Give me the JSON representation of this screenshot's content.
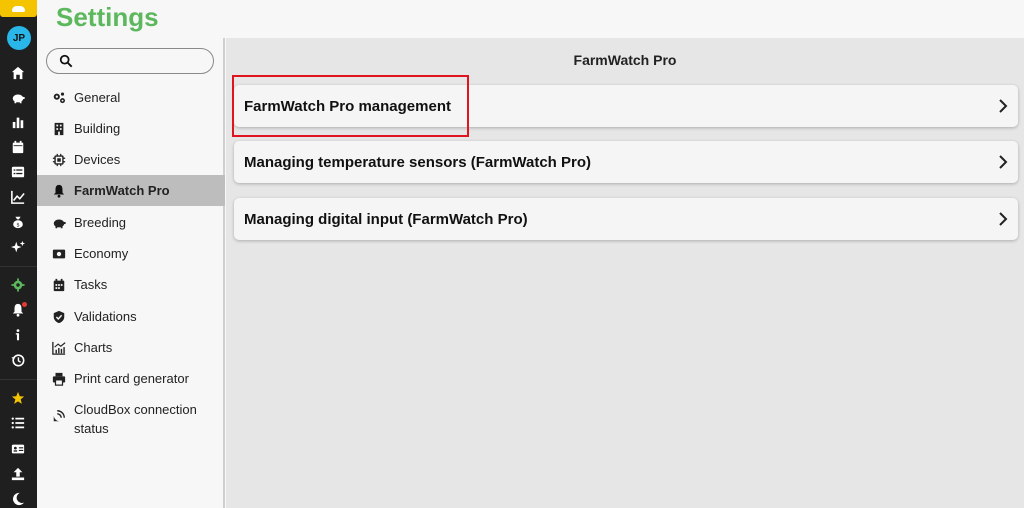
{
  "app": {
    "title": "Settings"
  },
  "rail": {
    "avatar_initials": "JP",
    "icons": [
      "home-icon",
      "piggy-bank-icon",
      "bar-chart-icon",
      "calendar-icon",
      "list-icon",
      "line-chart-icon",
      "money-bag-icon",
      "sparkles-icon",
      "gear-icon",
      "bell-icon",
      "info-icon",
      "history-icon",
      "star-icon",
      "list-icon",
      "id-card-icon",
      "upload-icon",
      "moon-icon"
    ]
  },
  "search": {
    "placeholder": ""
  },
  "nav": {
    "items": [
      {
        "label": "General",
        "icon": "gears-icon"
      },
      {
        "label": "Building",
        "icon": "building-icon"
      },
      {
        "label": "Devices",
        "icon": "chip-icon"
      },
      {
        "label": "FarmWatch Pro",
        "icon": "bell-icon",
        "active": true
      },
      {
        "label": "Breeding",
        "icon": "piggy-bank-icon"
      },
      {
        "label": "Economy",
        "icon": "money-icon"
      },
      {
        "label": "Tasks",
        "icon": "calendar-icon"
      },
      {
        "label": "Validations",
        "icon": "shield-check-icon"
      },
      {
        "label": "Charts",
        "icon": "chart-icon"
      },
      {
        "label": "Print card generator",
        "icon": "printer-icon"
      },
      {
        "label": "CloudBox connection status",
        "icon": "satellite-icon"
      }
    ]
  },
  "main": {
    "header": "FarmWatch Pro",
    "cards": [
      {
        "label": "FarmWatch Pro management"
      },
      {
        "label": "Managing temperature sensors (FarmWatch Pro)"
      },
      {
        "label": "Managing digital input (FarmWatch Pro)"
      }
    ]
  },
  "colors": {
    "accent_green": "#5cb85c",
    "rail_bg": "#1f1f1f",
    "highlight_red": "#e0141e",
    "logo_yellow": "#f5c400",
    "avatar_blue": "#29b6e8"
  }
}
